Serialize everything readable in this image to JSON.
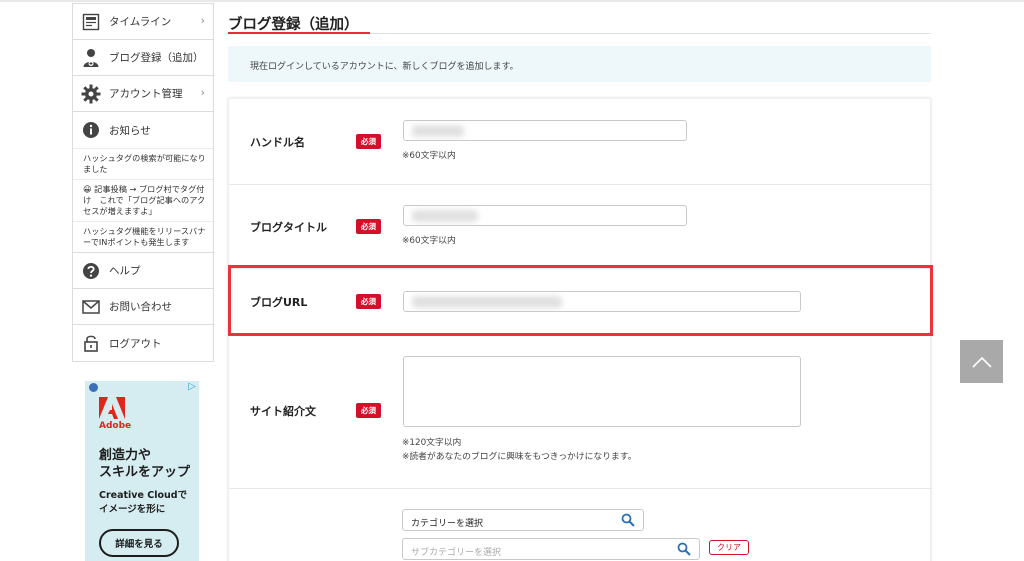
{
  "page": {
    "title": "ブログ登録（追加）",
    "info": "現在ログインしているアカウントに、新しくブログを追加します。"
  },
  "sidebar": {
    "items": [
      {
        "label": "タイムライン",
        "icon": "newspaper-icon",
        "chevron": "›"
      },
      {
        "label": "ブログ登録（追加）",
        "icon": "user-add-icon"
      },
      {
        "label": "アカウント管理",
        "icon": "gear-icon",
        "chevron": "›"
      },
      {
        "label": "お知らせ",
        "icon": "info-icon"
      }
    ],
    "news": [
      "ハッシュタグの検索が可能になりました",
      "😀 記事投稿 → ブログ村でタグ付け　これで「ブログ記事へのアクセスが増えますよ」",
      "ハッシュタグ機能をリリースバナーでINポイントも発生します"
    ],
    "bottom": [
      {
        "label": "ヘルプ",
        "icon": "help-icon"
      },
      {
        "label": "お問い合わせ",
        "icon": "mail-icon"
      },
      {
        "label": "ログアウト",
        "icon": "lock-icon"
      }
    ]
  },
  "ad": {
    "brand": "Adobe",
    "headline_1": "創造力や",
    "headline_2": "スキルをアップ",
    "sub_1": "Creative Cloudで",
    "sub_2": "イメージを形に",
    "cta": "詳細を見る",
    "adchoice": "▷"
  },
  "form": {
    "required_label": "必須",
    "handle": {
      "label": "ハンドル名",
      "note": "※60文字以内"
    },
    "blog_title": {
      "label": "ブログタイトル",
      "note": "※60文字以内"
    },
    "blog_url": {
      "label": "ブログURL"
    },
    "site_intro": {
      "label": "サイト紹介文",
      "note_1": "※120文字以内",
      "note_2": "※読者があなたのブログに興味をもつきっかけになります。"
    },
    "category": {
      "value": "カテゴリーを選択",
      "sub_placeholder": "サブカテゴリーを選択",
      "clear": "クリア"
    }
  },
  "colors": {
    "accent": "#e0313a",
    "required": "#d3102a",
    "info_bg": "#eef7fa",
    "highlight": "#e8343b"
  }
}
